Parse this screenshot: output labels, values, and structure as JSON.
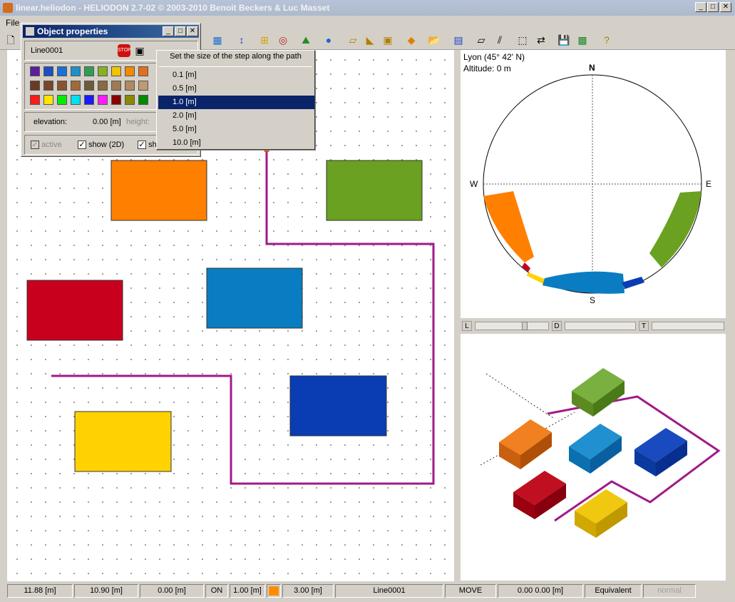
{
  "window": {
    "title": "linear.heliodon  -  HELIODON 2.7-02 © 2003-2010 Benoit Beckers & Luc Masset",
    "buttons": [
      "_",
      "□",
      "✕"
    ]
  },
  "menu": {
    "file": "File"
  },
  "object_properties": {
    "title": "Object properties",
    "object_name": "Line0001",
    "elevation_label": "elevation:",
    "elevation_value": "0.00 [m]",
    "height_label": "height:",
    "active_label": "active",
    "show2d_label": "show (2D)",
    "show3d_label": "sh",
    "swatch_colors": [
      [
        "#5b1f9e",
        "#1c4fc0",
        "#1d6fd6",
        "#1e90c8",
        "#2f9e52",
        "#88b024",
        "#f0c400",
        "#f08a00",
        "#e07020"
      ],
      [
        "#6b3a22",
        "#7a4628",
        "#8a532c",
        "#a06a3a",
        "#6e5a3a",
        "#8a6a40",
        "#a07a50",
        "#b08a60",
        "#c09a70"
      ],
      [
        "#ff1a1a",
        "#ffe600",
        "#00ee00",
        "#00e0ee",
        "#1a1aff",
        "#ff1aff",
        "#8a0000",
        "#8a8a00",
        "#008a00"
      ]
    ]
  },
  "step_popup": {
    "header": "Set the size of the step along the path",
    "options": [
      "0.1 [m]",
      "0.5 [m]",
      "1.0 [m]",
      "2.0 [m]",
      "5.0 [m]",
      "10.0 [m]"
    ],
    "selected": "1.0 [m]"
  },
  "sun_chart": {
    "location": "Lyon (45° 42' N)",
    "altitude": "Altitude: 0 m",
    "north": "N",
    "south": "S",
    "east": "E",
    "west": "W"
  },
  "sliders": {
    "l": "L",
    "d": "D",
    "t": "T"
  },
  "status": {
    "x": "11.88 [m]",
    "y": "10.90 [m]",
    "z": "0.00 [m]",
    "snap": "ON",
    "grid": "1.00 [m]",
    "height": "3.00 [m]",
    "object": "Line0001",
    "mode": "MOVE",
    "coords": "0.00     0.00 [m]",
    "projection": "Equivalent",
    "render": "normal",
    "color": "#ff8c00"
  },
  "colors": {
    "orange": "#ff7f00",
    "green": "#6aa121",
    "red": "#c8001e",
    "cyan_blue": "#0a7dc2",
    "dark_blue": "#0a3cb4",
    "yellow": "#ffd200",
    "path": "#a01a8a"
  }
}
